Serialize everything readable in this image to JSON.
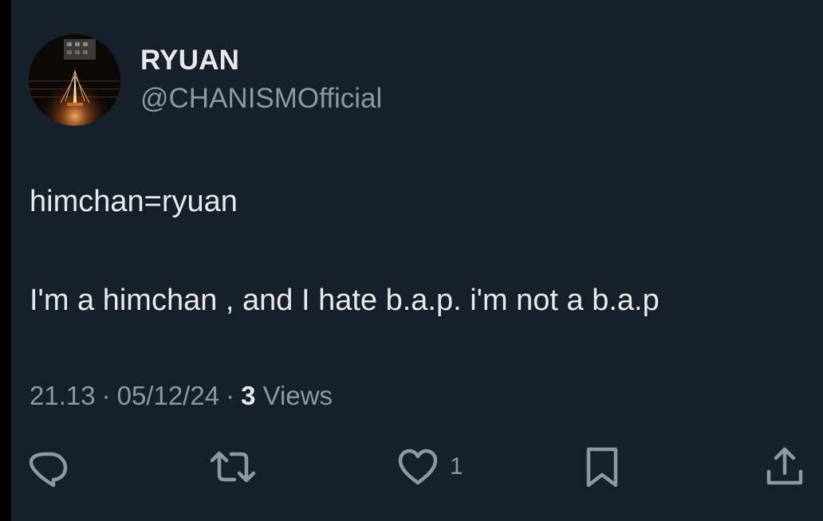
{
  "author": {
    "display_name": "RYUAN",
    "handle": "@CHANISMOfficial"
  },
  "tweet": {
    "lines": [
      "himchan=ryuan",
      "I'm a himchan , and I hate b.a.p. i'm not a b.a.p"
    ]
  },
  "meta": {
    "time": "21.13",
    "separator": "·",
    "date": "05/12/24",
    "views_count": "3",
    "views_label": "Views"
  },
  "actions": {
    "reply_icon": "reply-icon",
    "retweet_icon": "retweet-icon",
    "like_icon": "heart-icon",
    "like_count": "1",
    "bookmark_icon": "bookmark-icon",
    "share_icon": "share-icon"
  },
  "colors": {
    "background": "#15202b",
    "primary_text": "#e7e9ea",
    "secondary_text": "#8b98a5"
  }
}
